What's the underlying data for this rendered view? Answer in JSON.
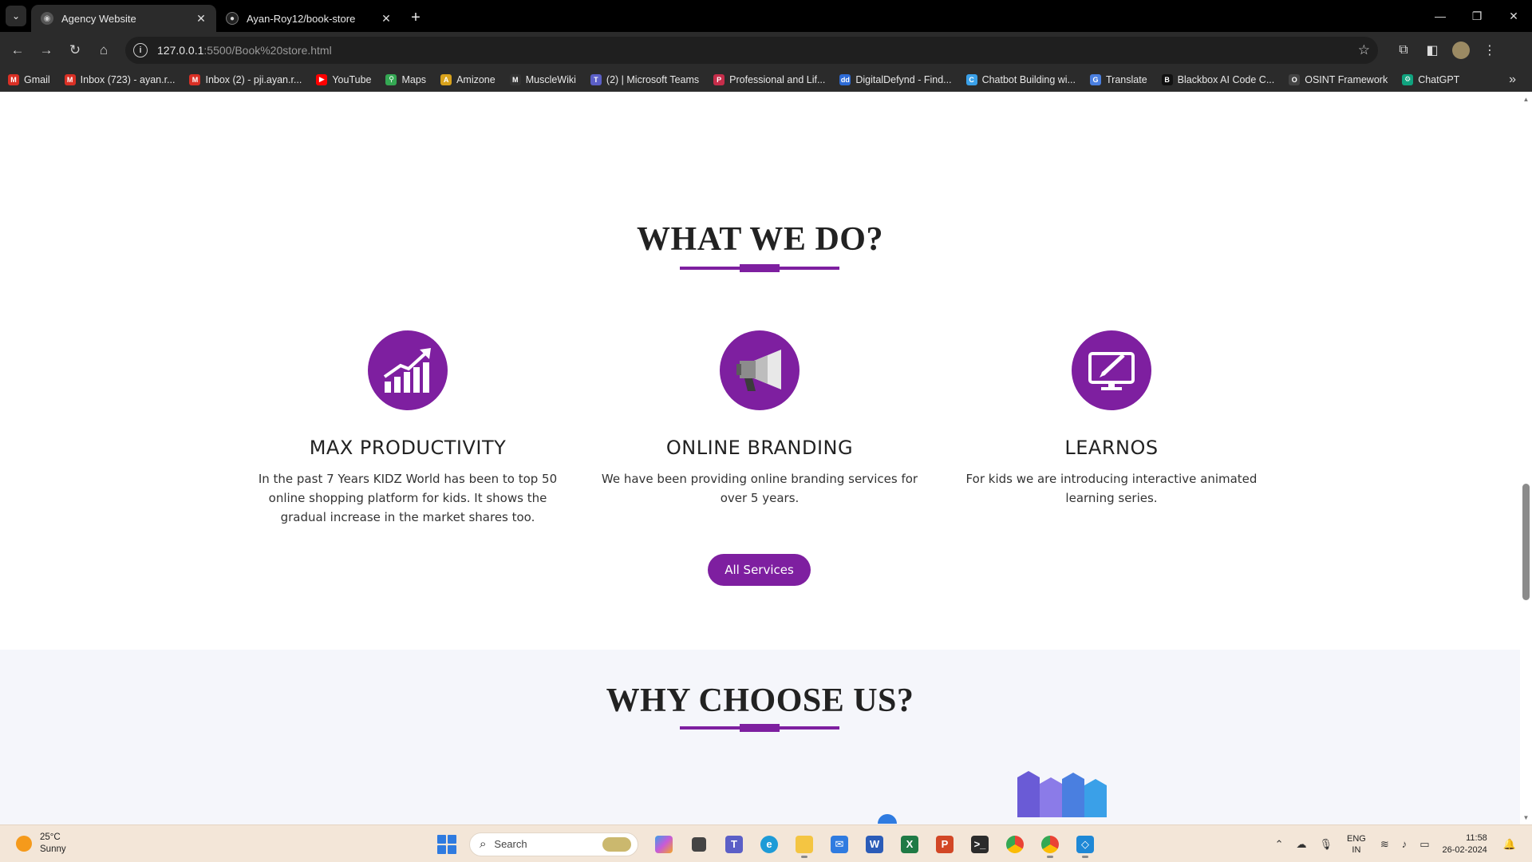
{
  "browser": {
    "tabs": [
      {
        "title": "Agency Website",
        "active": true
      },
      {
        "title": "Ayan-Roy12/book-store",
        "active": false
      }
    ],
    "url_host": "127.0.0.1",
    "url_path": ":5500/Book%20store.html",
    "bookmarks": [
      {
        "label": "Gmail",
        "color": "#d93025",
        "glyph": "M"
      },
      {
        "label": "Inbox (723) - ayan.r...",
        "color": "#d93025",
        "glyph": "M"
      },
      {
        "label": "Inbox (2) - pji.ayan.r...",
        "color": "#d93025",
        "glyph": "M"
      },
      {
        "label": "YouTube",
        "color": "#ff0000",
        "glyph": "▶"
      },
      {
        "label": "Maps",
        "color": "#34a853",
        "glyph": "⚲"
      },
      {
        "label": "Amizone",
        "color": "#d8a21c",
        "glyph": "A"
      },
      {
        "label": "MuscleWiki",
        "color": "#333333",
        "glyph": "M"
      },
      {
        "label": "(2) | Microsoft Teams",
        "color": "#5b5fc7",
        "glyph": "T"
      },
      {
        "label": "Professional and Lif...",
        "color": "#c62d4a",
        "glyph": "P"
      },
      {
        "label": "DigitalDefynd - Find...",
        "color": "#2d6bd6",
        "glyph": "dd"
      },
      {
        "label": "Chatbot Building wi...",
        "color": "#3aa0e8",
        "glyph": "C"
      },
      {
        "label": "Translate",
        "color": "#4a7fe0",
        "glyph": "G"
      },
      {
        "label": "Blackbox AI Code C...",
        "color": "#111111",
        "glyph": "B"
      },
      {
        "label": "OSINT Framework",
        "color": "#444444",
        "glyph": "O"
      },
      {
        "label": "ChatGPT",
        "color": "#10a37f",
        "glyph": "⚙"
      }
    ]
  },
  "page": {
    "what_title": "WHAT WE DO?",
    "services": [
      {
        "title": "MAX PRODUCTIVITY",
        "text": "In the past 7 Years KIDZ World has been to top 50 online shopping platform for kids. It shows the gradual increase in the market shares too.",
        "icon": "chart-growth-icon"
      },
      {
        "title": "ONLINE BRANDING",
        "text": "We have been providing online branding services for over 5 years.",
        "icon": "megaphone-icon"
      },
      {
        "title": "LEARNOS",
        "text": "For kids we are introducing interactive animated learning series.",
        "icon": "monitor-pen-icon"
      }
    ],
    "all_services_label": "All Services",
    "why_title": "WHY CHOOSE US?",
    "accent_color": "#7e1fa0"
  },
  "taskbar": {
    "temperature": "25°C",
    "weather": "Sunny",
    "search_placeholder": "Search",
    "lang_top": "ENG",
    "lang_bottom": "IN",
    "time": "11:58",
    "date": "26-02-2024"
  }
}
